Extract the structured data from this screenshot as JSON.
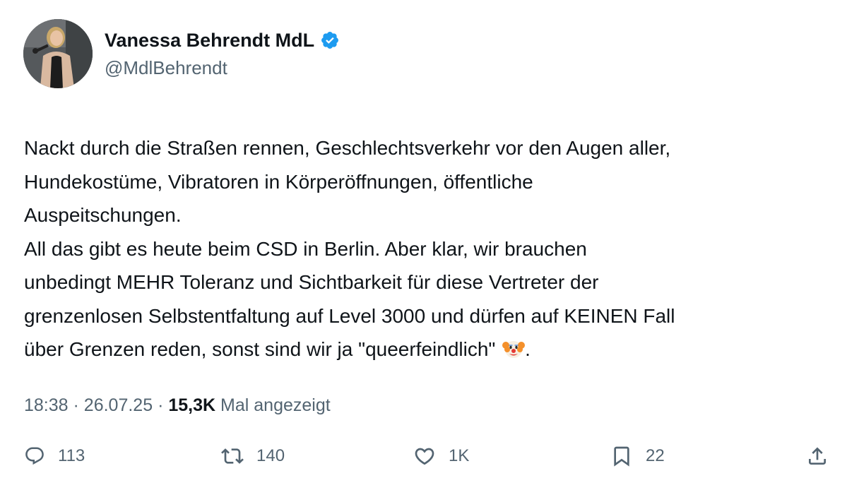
{
  "author": {
    "display_name": "Vanessa Behrendt MdL",
    "handle": "@MdlBehrendt",
    "verified_icon": "verified-badge-icon",
    "badge_color": "#1d9bf0"
  },
  "tweet": {
    "lines": [
      "Nackt durch die Straßen rennen, Geschlechtsverkehr vor den Augen aller,",
      "Hundekostüme, Vibratoren in Körperöffnungen, öffentliche",
      "Auspeitschungen.",
      "All das gibt es heute beim CSD in Berlin. Aber klar, wir brauchen",
      "unbedingt MEHR Toleranz und Sichtbarkeit für diese Vertreter der",
      "grenzenlosen Selbstentfaltung auf Level 3000 und dürfen auf KEINEN Fall",
      "über Grenzen reden, sonst sind wir ja \"queerfeindlich\"",
      "."
    ],
    "emoji": "clown-face-emoji"
  },
  "meta": {
    "time": "18:38",
    "separator": "·",
    "date": "26.07.25",
    "views_count": "15,3K",
    "views_label": "Mal angezeigt"
  },
  "actions": {
    "reply_count": "113",
    "retweet_count": "140",
    "like_count": "1K",
    "bookmark_count": "22",
    "icons": [
      "reply-icon",
      "retweet-icon",
      "like-icon",
      "bookmark-icon",
      "share-icon"
    ]
  },
  "colors": {
    "text": "#0f1419",
    "secondary": "#536471",
    "accent": "#1d9bf0"
  }
}
